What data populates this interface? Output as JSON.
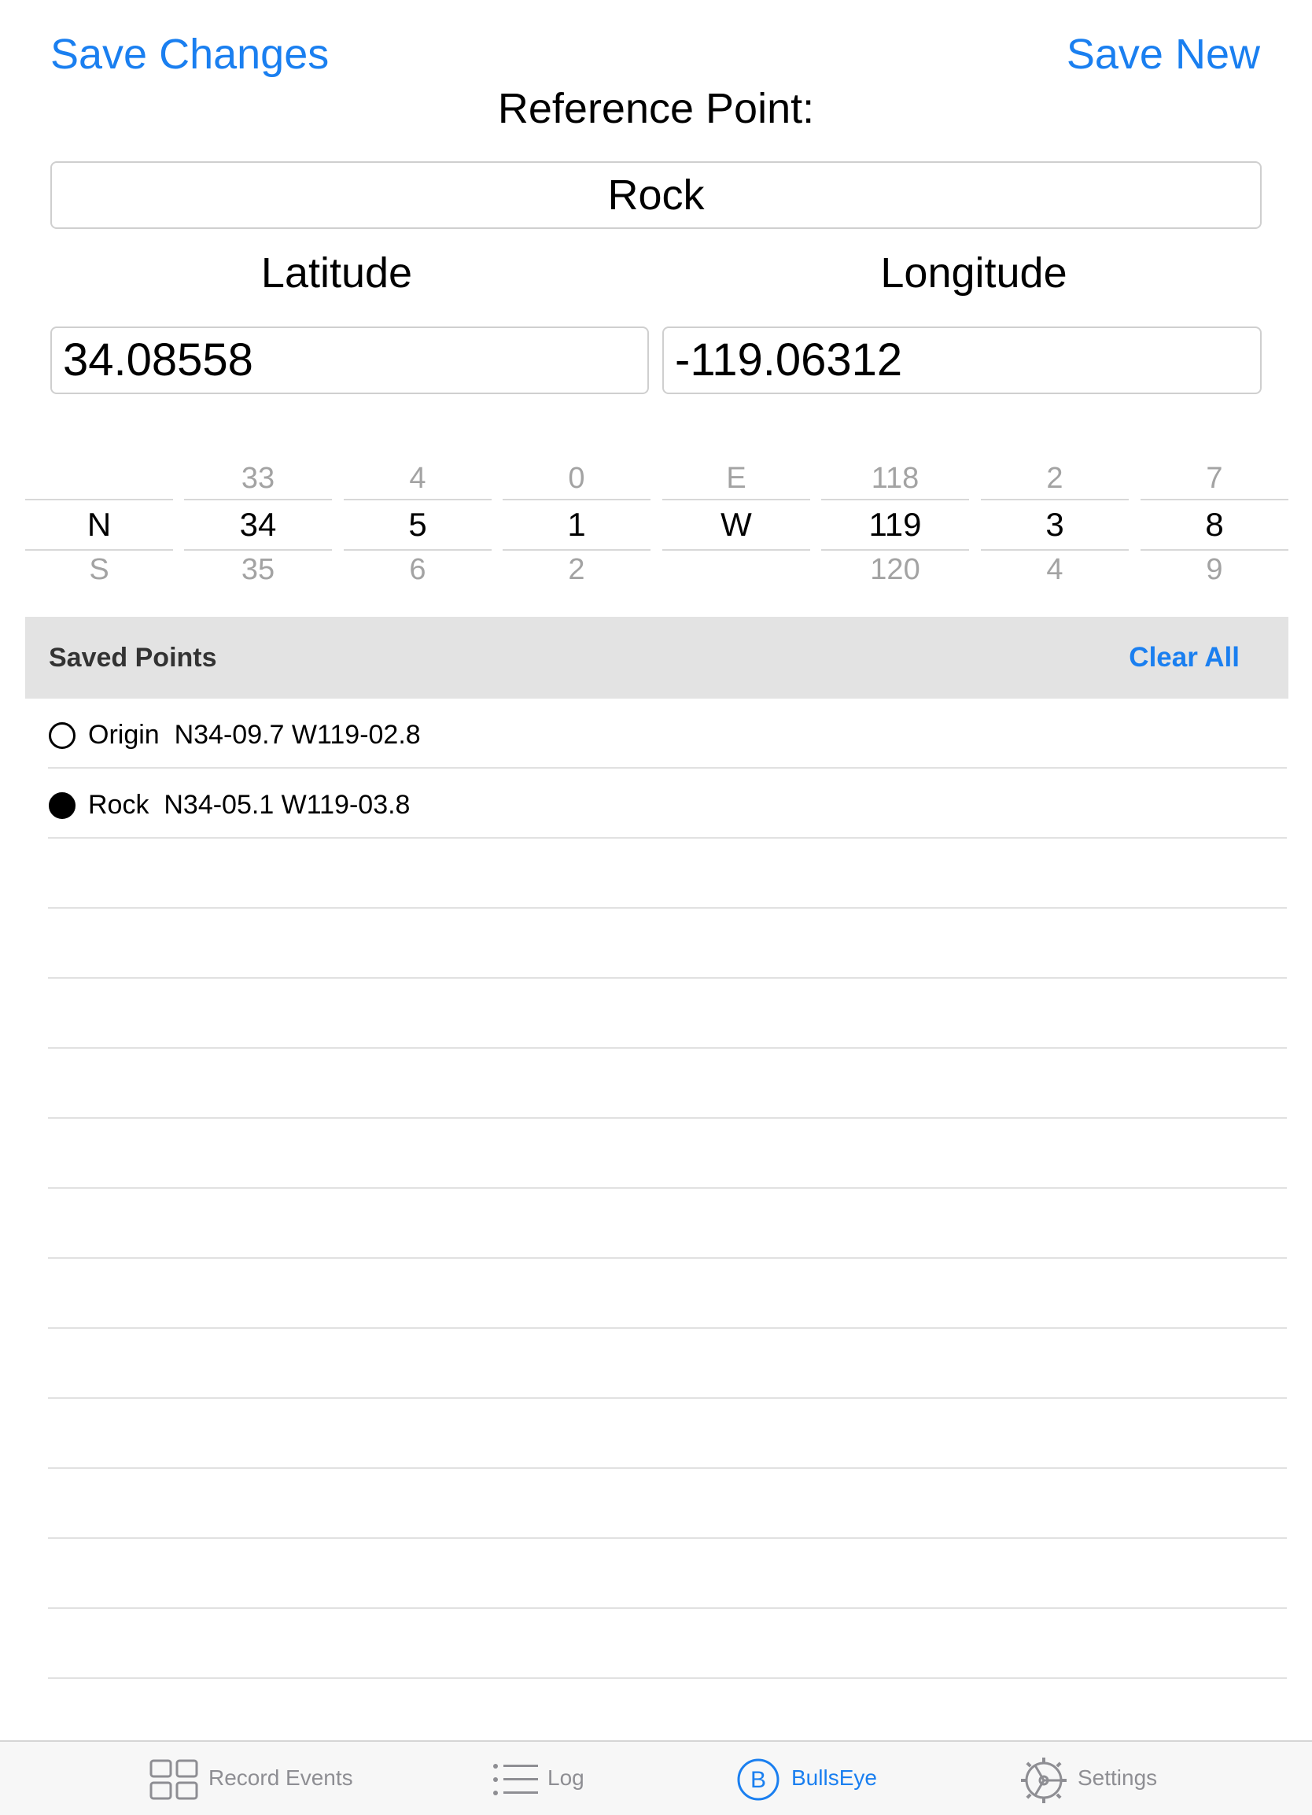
{
  "toolbar": {
    "save_changes_label": "Save Changes",
    "save_new_label": "Save New"
  },
  "reference": {
    "title": "Reference Point:",
    "name": "Rock"
  },
  "coordinates": {
    "latitude_label": "Latitude",
    "longitude_label": "Longitude",
    "latitude_value": "34.08558",
    "longitude_value": "-119.06312"
  },
  "picker": {
    "columns": [
      {
        "above": "",
        "selected": "N",
        "below": "S"
      },
      {
        "above": "33",
        "selected": "34",
        "below": "35"
      },
      {
        "above": "4",
        "selected": "5",
        "below": "6"
      },
      {
        "above": "0",
        "selected": "1",
        "below": "2"
      },
      {
        "above": "E",
        "selected": "W",
        "below": ""
      },
      {
        "above": "118",
        "selected": "119",
        "below": "120"
      },
      {
        "above": "2",
        "selected": "3",
        "below": "4"
      },
      {
        "above": "7",
        "selected": "8",
        "below": "9"
      }
    ]
  },
  "saved_points": {
    "header": "Saved Points",
    "clear_all_label": "Clear All",
    "items": [
      {
        "label": "Origin  N34-09.7 W119-02.8",
        "selected": false
      },
      {
        "label": "Rock  N34-05.1 W119-03.8",
        "selected": true
      }
    ]
  },
  "tabbar": {
    "tabs": [
      {
        "label": "Record Events",
        "icon": "grid-icon",
        "active": false
      },
      {
        "label": "Log",
        "icon": "list-icon",
        "active": false
      },
      {
        "label": "BullsEye",
        "icon": "bullseye-b-icon",
        "active": true
      },
      {
        "label": "Settings",
        "icon": "gear-icon",
        "active": false
      }
    ]
  },
  "colors": {
    "accent": "#1a7ff0",
    "header_bg": "#e3e3e3",
    "inactive_tab": "#8e8e93"
  }
}
